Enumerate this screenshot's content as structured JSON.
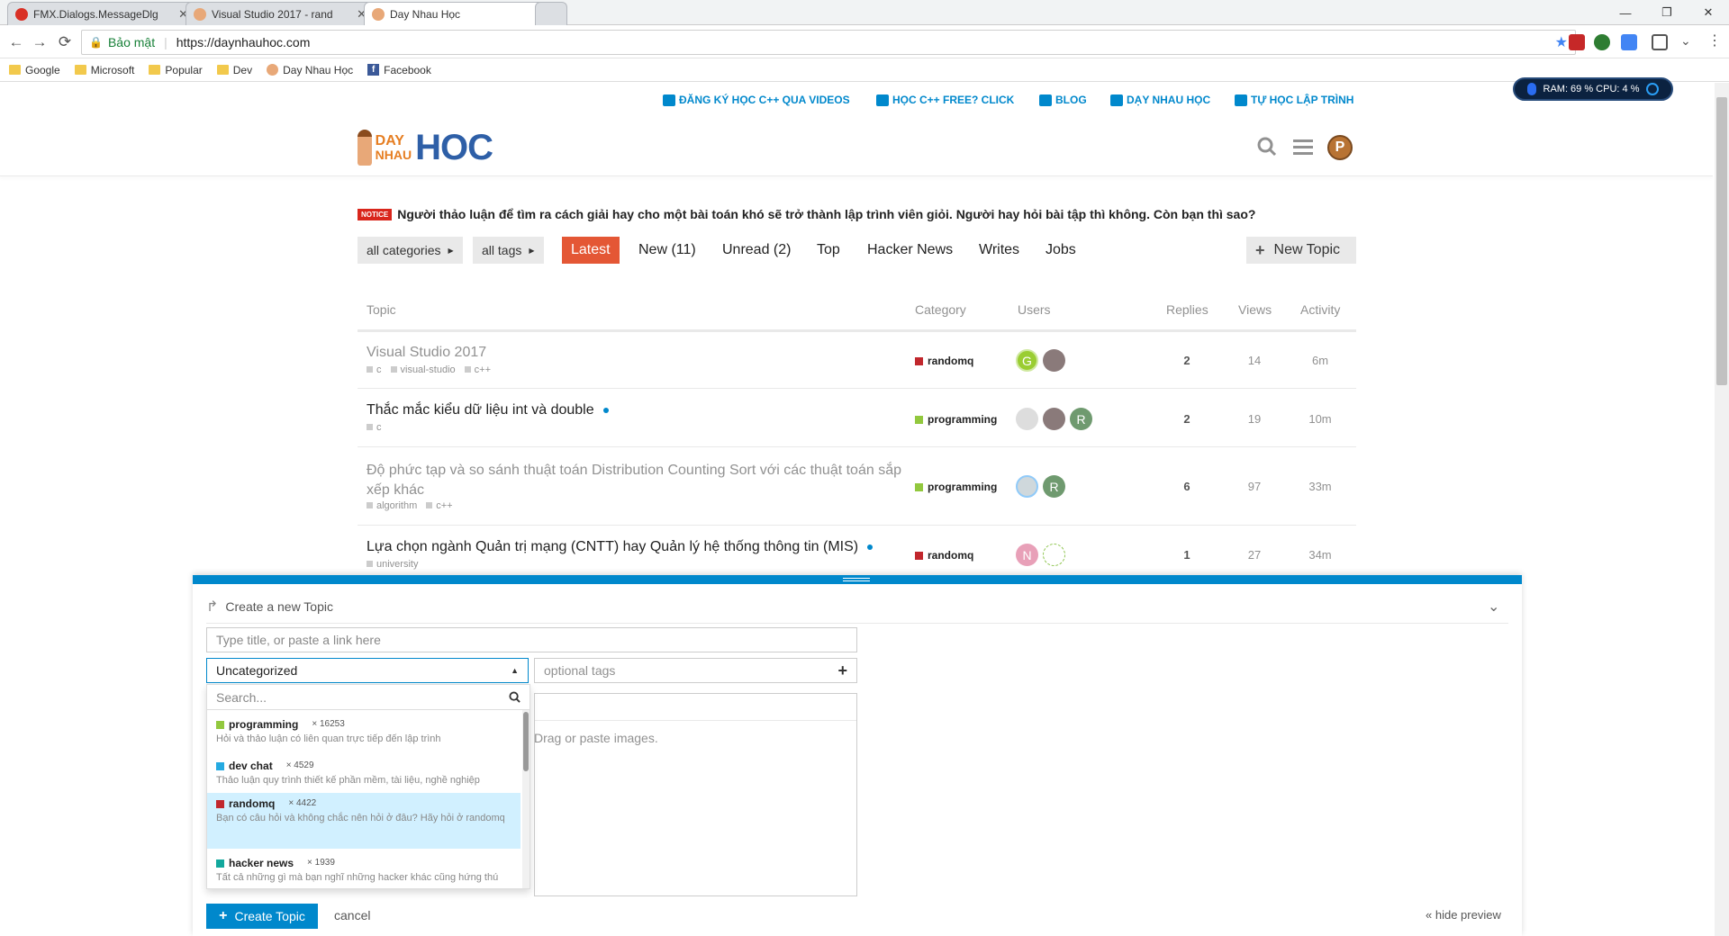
{
  "browser": {
    "tabs": [
      {
        "title": "FMX.Dialogs.MessageDlg",
        "close": "✕",
        "icon_color": "#d93025"
      },
      {
        "title": "Visual Studio 2017 - rand",
        "close": "✕",
        "icon_color": "#e8a878"
      },
      {
        "title": "Day Nhau Học",
        "close": "✕",
        "icon_color": "#e8a878"
      }
    ],
    "window_controls": {
      "minimize": "—",
      "maximize": "❐",
      "close": "✕"
    },
    "nav": {
      "back": "←",
      "forward": "→",
      "reload": "⟳"
    },
    "security_label": "Bảo mật",
    "url": "https://daynhauhoc.com",
    "bookmarks": [
      {
        "label": "Google",
        "icon": "folder-icon"
      },
      {
        "label": "Microsoft",
        "icon": "folder-icon"
      },
      {
        "label": "Popular",
        "icon": "folder-icon"
      },
      {
        "label": "Dev",
        "icon": "folder-icon"
      },
      {
        "label": "Day Nhau Học",
        "icon": "face-icon"
      },
      {
        "label": "Facebook",
        "icon": "facebook-icon"
      }
    ],
    "ram_widget": "RAM: 69 %  CPU: 4 %"
  },
  "site": {
    "top_links": [
      {
        "label": "ĐĂNG KÝ HỌC C++ QUA VIDEOS",
        "icon": "video-icon"
      },
      {
        "label": "HỌC C++ FREE? CLICK",
        "icon": "book-icon"
      },
      {
        "label": "BLOG",
        "icon": "rss-icon"
      },
      {
        "label": "DẠY NHAU HỌC",
        "icon": "facebook-icon"
      },
      {
        "label": "TỰ HỌC LẬP TRÌNH",
        "icon": "facebook-icon"
      }
    ],
    "logo": {
      "day": "DAY",
      "nhau": "NHAU",
      "hoc": "HOC"
    },
    "user_initial": "P",
    "notice_badge": "NOTICE",
    "notice_text": "Người thảo luận để tìm ra cách giải hay cho một bài toán khó sẽ trở thành lập trình viên giỏi. Người hay hỏi bài tập thì không. Còn bạn thì sao?"
  },
  "filters": {
    "categories": "all categories",
    "tags": "all tags",
    "nav": [
      "Latest",
      "New (11)",
      "Unread (2)",
      "Top",
      "Hacker News",
      "Writes",
      "Jobs"
    ],
    "new_topic": "New Topic"
  },
  "table": {
    "headers": {
      "topic": "Topic",
      "category": "Category",
      "users": "Users",
      "replies": "Replies",
      "views": "Views",
      "activity": "Activity"
    },
    "rows": [
      {
        "title": "Visual Studio 2017",
        "tags": [
          "c",
          "visual-studio",
          "c++"
        ],
        "category": "randomq",
        "cat_color": "#c1272d",
        "replies": "2",
        "views": "14",
        "activity": "6m"
      },
      {
        "title": "Thắc mắc kiểu dữ liệu int và double",
        "tags": [
          "c"
        ],
        "category": "programming",
        "cat_color": "#92c83e",
        "replies": "2",
        "views": "19",
        "activity": "10m"
      },
      {
        "title": "Độ phức tạp và so sánh thuật toán Distribution Counting Sort với các thuật toán sắp",
        "title2": "xếp khác",
        "tags": [
          "algorithm",
          "c++"
        ],
        "category": "programming",
        "cat_color": "#92c83e",
        "replies": "6",
        "views": "97",
        "activity": "33m"
      },
      {
        "title": "Lựa chọn ngành Quản trị mạng (CNTT) hay Quản lý hệ thống thông tin (MIS)",
        "tags": [
          "university"
        ],
        "category": "randomq",
        "cat_color": "#c1272d",
        "replies": "1",
        "views": "27",
        "activity": "34m"
      }
    ],
    "avatars": [
      "G",
      "R",
      "R",
      "N"
    ]
  },
  "composer": {
    "header": "Create a new Topic",
    "title_placeholder": "Type title, or paste a link here",
    "category_selected": "Uncategorized",
    "tags_placeholder": "optional tags",
    "drag_text": "Drag or paste images.",
    "search_placeholder": "Search...",
    "options": [
      {
        "name": "programming",
        "count": "× 16253",
        "desc": "Hỏi và thảo luận có liên quan trực tiếp đến lập trình",
        "color": "#92c83e"
      },
      {
        "name": "dev chat",
        "count": "× 4529",
        "desc": "Thảo luận quy trình thiết kế phần mềm, tài liệu, nghề nghiệp",
        "color": "#25aae1"
      },
      {
        "name": "randomq",
        "count": "× 4422",
        "desc": "Bạn có câu hỏi và không chắc nên hỏi ở đâu? Hãy hỏi ở randomq",
        "color": "#c1272d"
      },
      {
        "name": "hacker news",
        "count": "× 1939",
        "desc": "Tất cả những gì mà bạn nghĩ những hacker khác cũng hứng thú",
        "color": "#12a89d"
      }
    ],
    "create_button": "Create Topic",
    "cancel": "cancel",
    "hide_preview": "« hide preview"
  }
}
